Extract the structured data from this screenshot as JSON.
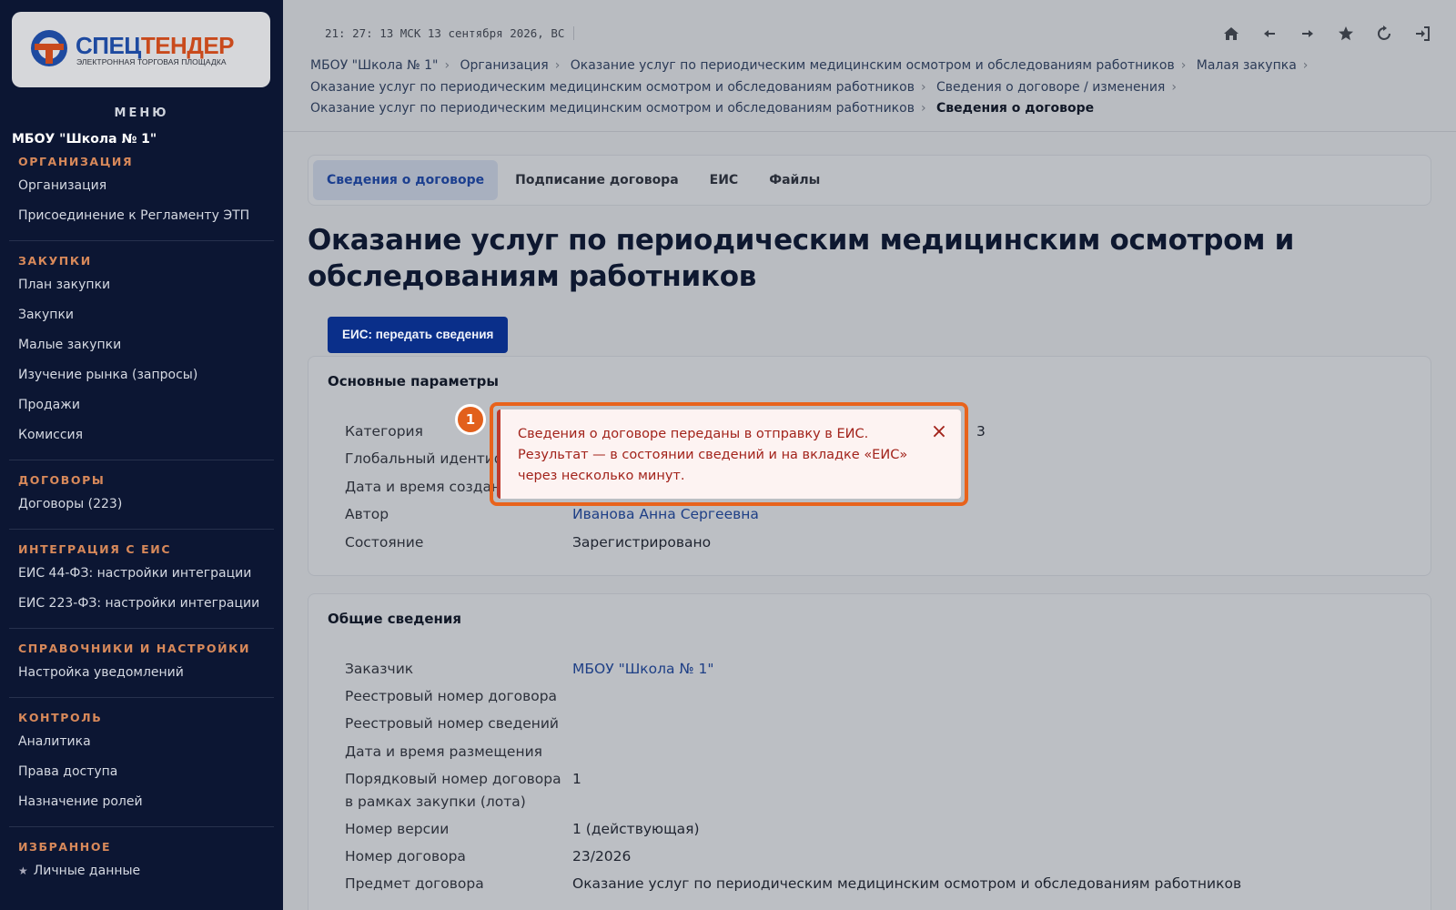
{
  "clock": "21: 27: 13 МСК  13 сентября 2026, ВС",
  "logo": {
    "title_part1": "СПЕЦ",
    "title_part2": "ТЕНДЕР",
    "subtitle": "ЭЛЕКТРОННАЯ ТОРГОВАЯ ПЛОЩАДКА"
  },
  "sidebar": {
    "menu_title": "МЕНЮ",
    "org_name": "МБОУ \"Школа № 1\"",
    "sections": [
      {
        "head": "ОРГАНИЗАЦИЯ",
        "items": [
          "Организация",
          "Присоединение к Регламенту ЭТП"
        ]
      },
      {
        "head": "ЗАКУПКИ",
        "items": [
          "План закупки",
          "Закупки",
          "Малые закупки",
          "Изучение рынка (запросы)",
          "Продажи",
          "Комиссия"
        ]
      },
      {
        "head": "ДОГОВОРЫ",
        "items": [
          "Договоры (223)"
        ]
      },
      {
        "head": "ИНТЕГРАЦИЯ С ЕИС",
        "items": [
          "ЕИС 44-ФЗ: настройки интеграции",
          "ЕИС 223-ФЗ: настройки интеграции"
        ]
      },
      {
        "head": "СПРАВОЧНИКИ И НАСТРОЙКИ",
        "items": [
          "Настройка уведомлений"
        ]
      },
      {
        "head": "КОНТРОЛЬ",
        "items": [
          "Аналитика",
          "Права доступа",
          "Назначение ролей"
        ]
      },
      {
        "head": "ИЗБРАННОЕ",
        "items": [
          "Личные данные"
        ]
      }
    ]
  },
  "top_icons": [
    "home-icon",
    "arrow-left-icon",
    "arrow-right-icon",
    "star-icon",
    "refresh-icon",
    "logout-icon"
  ],
  "breadcrumbs": {
    "line1": [
      "МБОУ \"Школа № 1\"",
      "Организация",
      "Оказание услуг по периодическим медицинским осмотром и обследованиям работников",
      "Малая закупка"
    ],
    "line2": [
      "Оказание услуг по периодическим медицинским осмотром и обследованиям работников",
      "Сведения о договоре / изменения"
    ],
    "line3": [
      "Оказание услуг по периодическим медицинским осмотром и обследованиям работников"
    ],
    "current": "Сведения о договоре"
  },
  "tabs": [
    "Сведения о договоре",
    "Подписание договора",
    "ЕИС",
    "Файлы"
  ],
  "page_title": "Оказание услуг по периодическим медицинским осмотром и обследованиям работников",
  "eis_button": "ЕИС: передать сведения",
  "main_params": {
    "title": "Основные параметры",
    "labels": [
      "Категория",
      "Глобальный идентификатор",
      "Дата и время создания",
      "Автор",
      "Состояние"
    ],
    "category_value_tail": "3",
    "author": "Иванова Анна Сергеевна",
    "status": "Зарегистрировано"
  },
  "general": {
    "title": "Общие сведения",
    "rows": [
      {
        "label": "Заказчик",
        "value": "МБОУ \"Школа № 1\""
      },
      {
        "label": "Реестровый номер договора",
        "value": ""
      },
      {
        "label": "Реестровый номер сведений",
        "value": ""
      },
      {
        "label": "Дата и время размещения",
        "value": ""
      },
      {
        "label": "Порядковый номер договора",
        "label2": "в рамках закупки (лота)",
        "value": "1"
      },
      {
        "label": "Номер версии",
        "value": "1 (действующая)"
      },
      {
        "label": "Номер договора",
        "value": "23/2026"
      },
      {
        "label": "Предмет договора",
        "value": "Оказание услуг по периодическим медицинским осмотром и обследованиям работников"
      }
    ]
  },
  "toast": {
    "badge": "1",
    "line1": "Сведения о договоре переданы в отправку в ЕИС.",
    "line2": "Результат — в состоянии сведений и на вкладке «ЕИС»",
    "line3": "через несколько минут.",
    "close": "×"
  },
  "colors": {
    "sidebar_bg": "#0c1633",
    "accent_orange": "#e8631c",
    "primary_blue": "#0a2f8a",
    "toast_text": "#a2231b"
  }
}
